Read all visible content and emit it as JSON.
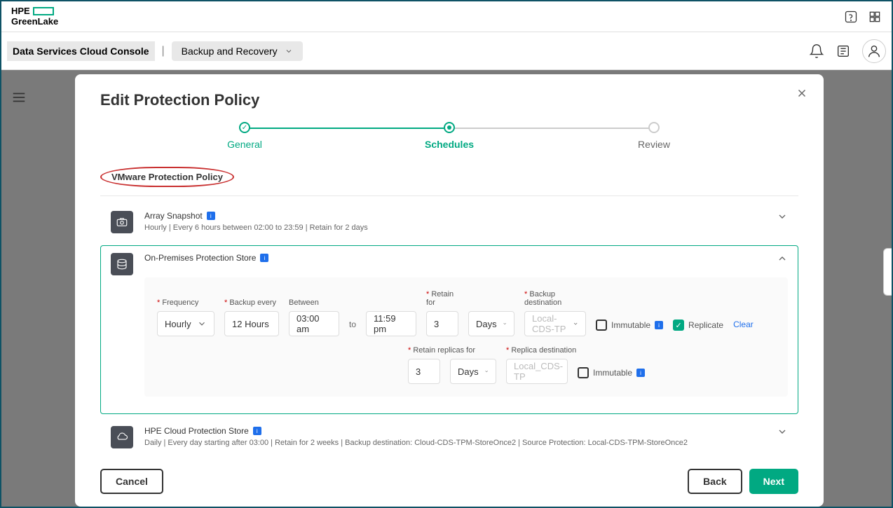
{
  "header": {
    "logo_top": "HPE",
    "logo_bottom": "GreenLake"
  },
  "subheader": {
    "console": "Data Services Cloud Console",
    "dropdown": "Backup and Recovery"
  },
  "modal": {
    "title": "Edit Protection Policy",
    "steps": {
      "general": "General",
      "schedules": "Schedules",
      "review": "Review"
    },
    "policy_name": "VMware Protection Policy",
    "sections": {
      "array": {
        "title": "Array Snapshot",
        "desc": "Hourly | Every 6 hours between 02:00 to 23:59 | Retain for 2 days"
      },
      "onprem": {
        "title": "On-Premises Protection Store",
        "labels": {
          "frequency": "Frequency",
          "backup_every": "Backup every",
          "between": "Between",
          "to": "to",
          "retain_for": "Retain for",
          "backup_dest": "Backup destination",
          "immutable": "Immutable",
          "replicate": "Replicate",
          "clear": "Clear",
          "retain_replicas": "Retain replicas for",
          "replica_dest": "Replica destination"
        },
        "values": {
          "frequency": "Hourly",
          "backup_every": "12 Hours",
          "between_start": "03:00 am",
          "between_end": "11:59 pm",
          "retain_for_val": "3",
          "retain_for_unit": "Days",
          "backup_dest": "Local-CDS-TP",
          "retain_replicas_val": "3",
          "retain_replicas_unit": "Days",
          "replica_dest": "Local_CDS-TP"
        }
      },
      "cloud": {
        "title": "HPE Cloud Protection Store",
        "desc": "Daily | Every day starting after 03:00 | Retain for 2 weeks | Backup destination: Cloud-CDS-TPM-StoreOnce2 | Source Protection: Local-CDS-TPM-StoreOnce2"
      }
    },
    "footer": {
      "cancel": "Cancel",
      "back": "Back",
      "next": "Next"
    }
  }
}
